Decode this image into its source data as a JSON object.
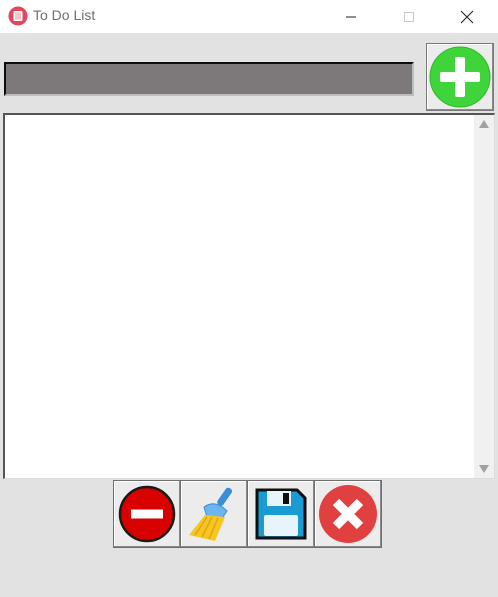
{
  "window": {
    "title": "To Do List",
    "icon": "app-icon"
  },
  "caption_buttons": {
    "minimize": "minimize-icon",
    "maximize": "maximize-icon",
    "close": "close-icon"
  },
  "task_entry": {
    "value": "",
    "placeholder": ""
  },
  "add_button": {
    "icon": "plus-icon",
    "color": "#3fd43a"
  },
  "task_list": {
    "items": []
  },
  "toolbar": {
    "buttons": [
      {
        "action": "delete",
        "icon": "minus-circle-icon",
        "color": "#d90000"
      },
      {
        "action": "clear",
        "icon": "broom-icon",
        "color": "#f3c21b"
      },
      {
        "action": "save",
        "icon": "floppy-disk-icon",
        "color": "#1b9bd3"
      },
      {
        "action": "exit",
        "icon": "x-circle-icon",
        "color": "#e0403f"
      }
    ]
  }
}
